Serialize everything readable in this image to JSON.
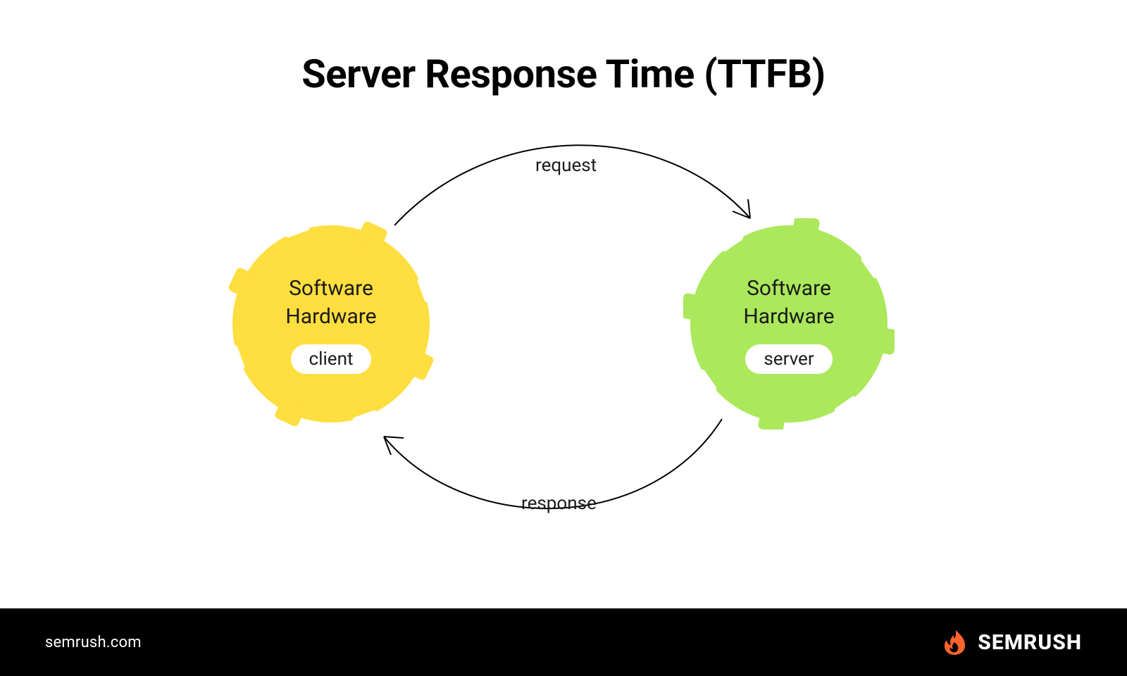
{
  "title": "Server Response Time (TTFB)",
  "arrows": {
    "request_label": "request",
    "response_label": "response"
  },
  "nodes": {
    "client": {
      "line1": "Software",
      "line2": "Hardware",
      "pill": "client",
      "color": "#FFDE3F"
    },
    "server": {
      "line1": "Software",
      "line2": "Hardware",
      "pill": "server",
      "color": "#ABE85B"
    }
  },
  "footer": {
    "url": "semrush.com",
    "brand": "SEMRUSH",
    "brand_color": "#FF642D"
  }
}
